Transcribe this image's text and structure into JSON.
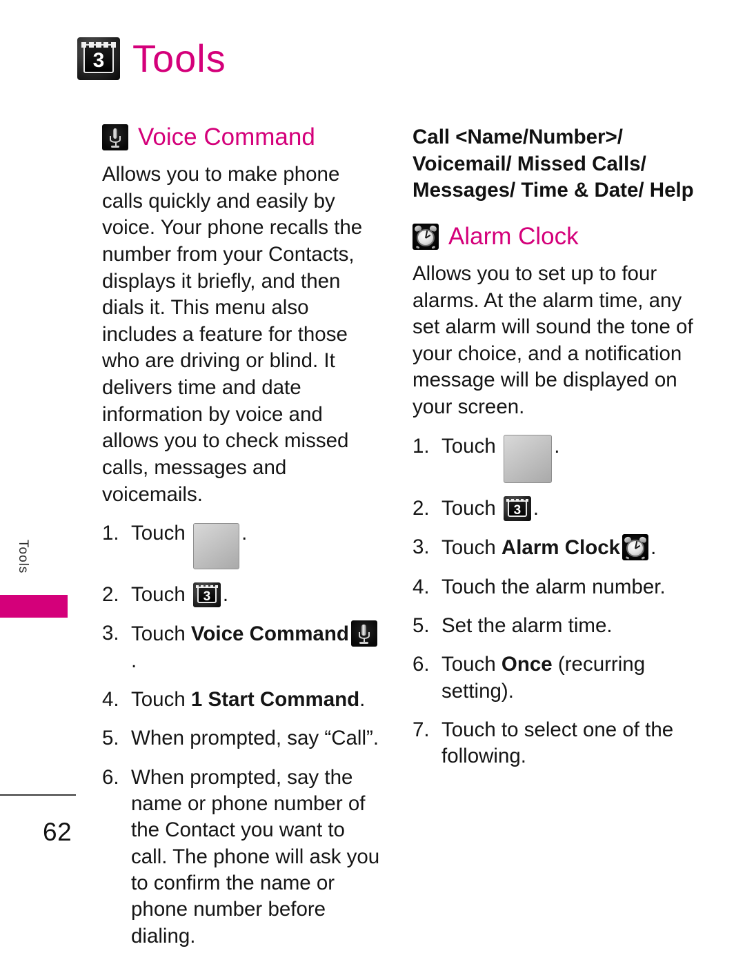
{
  "chapter": {
    "title": "Tools",
    "icon": "menu-three-icon",
    "side_label": "Tools",
    "page_number": "62"
  },
  "colors": {
    "accent": "#d4007a",
    "text": "#151515"
  },
  "left_column": {
    "section": {
      "title": "Voice Command",
      "icon": "microphone-icon",
      "body": "Allows you to make phone calls quickly and easily by voice. Your phone recalls the number from your Contacts, displays it briefly, and then dials it. This menu also includes a feature for those who are driving or blind. It delivers time and date information by voice and allows you to check missed calls, messages and voicemails."
    },
    "steps": [
      {
        "num": "1.",
        "pre": "Touch ",
        "icon": "grid-menu-icon",
        "post": "."
      },
      {
        "num": "2.",
        "pre": "Touch ",
        "icon": "menu-three-icon",
        "post": "."
      },
      {
        "num": "3.",
        "pre": "Touch ",
        "bold": "Voice Command",
        "icon": "microphone-icon",
        "post": "."
      },
      {
        "num": "4.",
        "pre": "Touch ",
        "bold": "1 Start Command",
        "post": "."
      },
      {
        "num": "5.",
        "pre": "When prompted, say “Call”."
      },
      {
        "num": "6.",
        "pre": "When prompted, say the name or phone number of the Contact you want to call. The phone will ask you to confirm the name or phone number before dialing."
      }
    ]
  },
  "right_column": {
    "lead_bold": "Call <Name/Number>/ Voicemail/ Missed Calls/ Messages/ Time & Date/ Help",
    "section": {
      "title": "Alarm Clock",
      "icon": "alarm-clock-icon",
      "body": "Allows you to set up to four alarms. At the alarm time, any set alarm will sound the tone of your choice, and a notification message will be displayed on your screen."
    },
    "steps": [
      {
        "num": "1.",
        "pre": "Touch ",
        "icon": "grid-menu-icon",
        "post": "."
      },
      {
        "num": "2.",
        "pre": "Touch ",
        "icon": "menu-three-icon",
        "post": "."
      },
      {
        "num": "3.",
        "pre": "Touch ",
        "bold": "Alarm Clock",
        "icon": "alarm-clock-icon",
        "post": "."
      },
      {
        "num": "4.",
        "pre": "Touch the alarm number."
      },
      {
        "num": "5.",
        "pre": "Set the alarm time."
      },
      {
        "num": "6.",
        "pre": "Touch ",
        "bold": "Once",
        "post": " (recurring setting)."
      },
      {
        "num": "7.",
        "pre": "Touch to select one of the following."
      }
    ]
  }
}
